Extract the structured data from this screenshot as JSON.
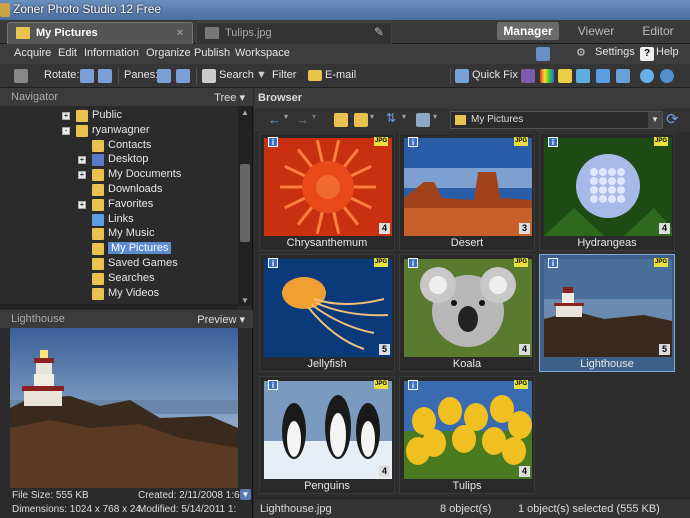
{
  "window": {
    "title": "Zoner Photo Studio 12 Free"
  },
  "tabs": [
    {
      "label": "My Pictures",
      "active": true
    },
    {
      "label": "Tulips.jpg",
      "active": false
    }
  ],
  "modes": {
    "manager": "Manager",
    "viewer": "Viewer",
    "editor": "Editor"
  },
  "menu": {
    "items": [
      "Acquire",
      "Edit",
      "Information",
      "Organize",
      "Publish",
      "Workspace"
    ],
    "settings": "Settings",
    "help": "Help"
  },
  "toolbar": {
    "rotate": "Rotate:",
    "panes": "Panes:",
    "search": "Search",
    "filter": "Filter",
    "email": "E-mail",
    "quickfix": "Quick Fix"
  },
  "navigator": {
    "title": "Navigator",
    "mode": "Tree",
    "tree": [
      {
        "label": "Public",
        "level": 1,
        "expander": "+"
      },
      {
        "label": "ryanwagner",
        "level": 1,
        "expander": "-"
      },
      {
        "label": "Contacts",
        "level": 2,
        "expander": ""
      },
      {
        "label": "Desktop",
        "level": 2,
        "expander": "+"
      },
      {
        "label": "My Documents",
        "level": 2,
        "expander": "+"
      },
      {
        "label": "Downloads",
        "level": 2,
        "expander": ""
      },
      {
        "label": "Favorites",
        "level": 2,
        "expander": "+"
      },
      {
        "label": "Links",
        "level": 2,
        "expander": ""
      },
      {
        "label": "My Music",
        "level": 2,
        "expander": ""
      },
      {
        "label": "My Pictures",
        "level": 2,
        "expander": "",
        "selected": true
      },
      {
        "label": "Saved Games",
        "level": 2,
        "expander": ""
      },
      {
        "label": "Searches",
        "level": 2,
        "expander": ""
      },
      {
        "label": "My Videos",
        "level": 2,
        "expander": ""
      }
    ]
  },
  "preview": {
    "title": "Lighthouse",
    "mode": "Preview",
    "file_size": "File Size: 555 KB",
    "created": "Created: 2/11/2008 1:6",
    "dimensions": "Dimensions: 1024 x 768 x 24",
    "modified": "Modified: 5/14/2011 1:"
  },
  "browser": {
    "title": "Browser",
    "path": "My Pictures",
    "thumbnails": [
      {
        "name": "Chrysanthemum",
        "rating": "4",
        "selected": false
      },
      {
        "name": "Desert",
        "rating": "3",
        "selected": false
      },
      {
        "name": "Hydrangeas",
        "rating": "4",
        "selected": false
      },
      {
        "name": "Jellyfish",
        "rating": "5",
        "selected": false
      },
      {
        "name": "Koala",
        "rating": "4",
        "selected": false
      },
      {
        "name": "Lighthouse",
        "rating": "5",
        "selected": true
      },
      {
        "name": "Penguins",
        "rating": "4",
        "selected": false
      },
      {
        "name": "Tulips",
        "rating": "4",
        "selected": false
      }
    ],
    "badges": {
      "info": "i",
      "format": "JPG"
    }
  },
  "status": {
    "file": "Lighthouse.jpg",
    "count": "8 object(s)",
    "selected": "1 object(s) selected (555 KB)"
  },
  "colors": {
    "accent_selected": "#3e5f88",
    "folder_yellow": "#e9c24f",
    "title_blue": "#4a6e9e"
  }
}
